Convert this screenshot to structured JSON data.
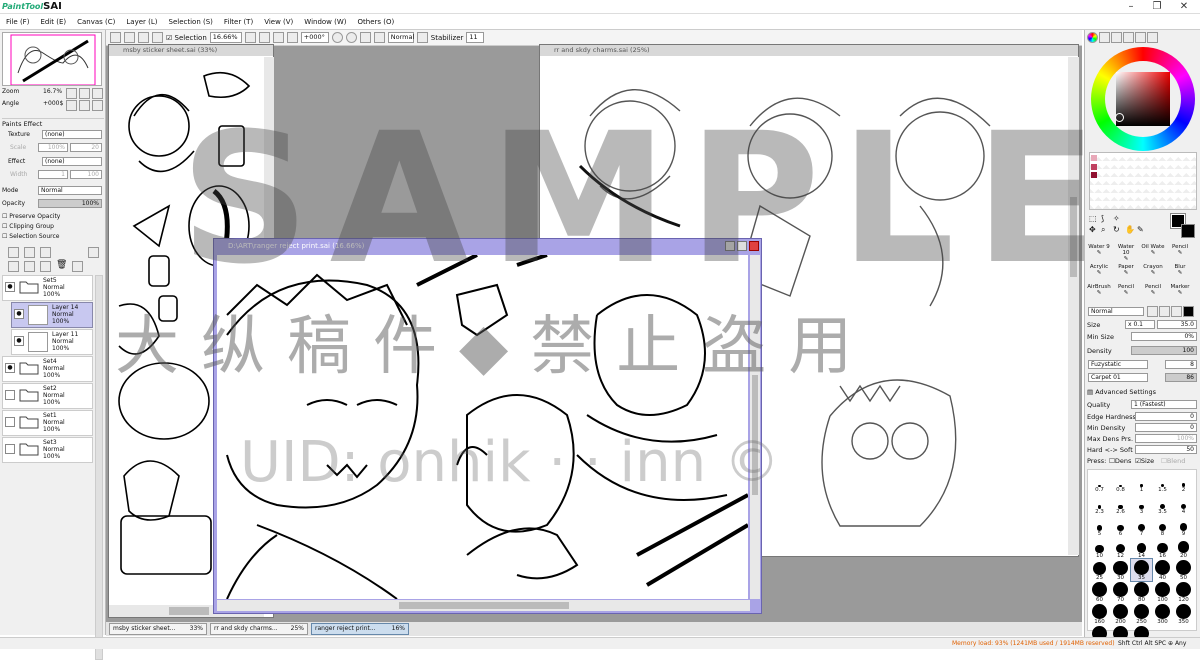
{
  "app": {
    "logo": "PaintTool",
    "logo_b": "SAI",
    "win_min": "–",
    "win_max": "❐",
    "win_close": "✕"
  },
  "menu": [
    "File (F)",
    "Edit (E)",
    "Canvas (C)",
    "Layer (L)",
    "Selection (S)",
    "Filter (T)",
    "View (V)",
    "Window (W)",
    "Others (O)"
  ],
  "toolbar": {
    "selection": "Selection",
    "zoom": "16.66%",
    "angle": "+000°",
    "mode": "Normal",
    "stabilizer_label": "Stabilizer",
    "stabilizer": "11"
  },
  "navigator": {
    "zoom_label": "Zoom",
    "zoom_value": "16.7%",
    "angle_label": "Angle",
    "angle_value": "+000$"
  },
  "paints_effect": {
    "title": "Paints Effect",
    "texture_label": "Texture",
    "texture_value": "(none)",
    "scale_label": "Scale",
    "scale_value": "100%",
    "scale_num": "20",
    "effect_label": "Effect",
    "effect_value": "(none)",
    "width_label": "Width",
    "width_value": "1",
    "width_num": "100"
  },
  "layer_props": {
    "mode_label": "Mode",
    "mode_value": "Normal",
    "opacity_label": "Opacity",
    "opacity_value": "100%",
    "preserve": "Preserve Opacity",
    "clipping": "Clipping Group",
    "selsrc": "Selection Source"
  },
  "layers": [
    {
      "name": "Set5",
      "mode": "Normal",
      "opacity": "100%",
      "type": "folder",
      "visible": true,
      "selected": false,
      "indent": 0
    },
    {
      "name": "Layer 14",
      "mode": "Normal",
      "opacity": "100%",
      "type": "layer",
      "visible": true,
      "selected": true,
      "indent": 1
    },
    {
      "name": "Layer 11",
      "mode": "Normal",
      "opacity": "100%",
      "type": "layer",
      "visible": true,
      "selected": false,
      "indent": 1
    },
    {
      "name": "Set4",
      "mode": "Normal",
      "opacity": "100%",
      "type": "folder",
      "visible": true,
      "selected": false,
      "indent": 0
    },
    {
      "name": "Set2",
      "mode": "Normal",
      "opacity": "100%",
      "type": "folder",
      "visible": false,
      "selected": false,
      "indent": 0
    },
    {
      "name": "Set1",
      "mode": "Normal",
      "opacity": "100%",
      "type": "folder",
      "visible": false,
      "selected": false,
      "indent": 0
    },
    {
      "name": "Set3",
      "mode": "Normal",
      "opacity": "100%",
      "type": "folder",
      "visible": false,
      "selected": false,
      "indent": 0
    }
  ],
  "windows": {
    "w1": "msby sticker sheet.sai (33%)",
    "w2": "rr and skdy charms.sai (25%)",
    "w3": "D:\\ART\\ranger reject print.sai (16.66%)"
  },
  "tasks": [
    {
      "name": "msby sticker sheet...",
      "zoom": "33%"
    },
    {
      "name": "rr and skdy charms...",
      "zoom": "25%"
    },
    {
      "name": "ranger reject print...",
      "zoom": "16%"
    }
  ],
  "tools": [
    "Water 9",
    "Water 10",
    "Oil Wate",
    "Pencil",
    "Acrylic",
    "Paper",
    "Crayon",
    "Blur",
    "AirBrush",
    "Pencil",
    "Pencil",
    "Marker"
  ],
  "brush": {
    "mode": "Normal",
    "size_label": "Size",
    "size_mult": "x 0.1",
    "size_value": "35.0",
    "minsize_label": "Min Size",
    "minsize_value": "0%",
    "density_label": "Density",
    "density_value": "100",
    "tex1": "Fuzystatic",
    "tex1_v": "8",
    "tex2": "Carpet 01",
    "tex2_v": "86",
    "adv": "Advanced Settings",
    "quality_label": "Quality",
    "quality_value": "1 (Fastest)",
    "edge_label": "Edge Hardness",
    "edge_value": "0",
    "mindens_label": "Min Density",
    "mindens_value": "0",
    "maxdens_label": "Max Dens Prs.",
    "maxdens_value": "100%",
    "hard_label": "Hard <-> Soft",
    "hard_value": "50",
    "press_label": "Press:",
    "dens": "Dens",
    "size": "Size",
    "blend": "Blend"
  },
  "brush_sizes": [
    "0.7",
    "0.8",
    "1",
    "1.5",
    "2",
    "2.3",
    "2.6",
    "3",
    "3.5",
    "4",
    "5",
    "6",
    "7",
    "8",
    "9",
    "10",
    "12",
    "14",
    "16",
    "20",
    "25",
    "30",
    "35",
    "40",
    "50",
    "60",
    "70",
    "80",
    "100",
    "120",
    "160",
    "200",
    "250",
    "300",
    "350",
    "400",
    "450",
    "500"
  ],
  "status": {
    "memory": "Memory load: 93% (1241MB used / 1914MB reserved)",
    "keys": "Shft Ctrl Alt SPC ⊕ Any"
  },
  "watermark": {
    "big": "SAMPLE",
    "cn": "大纵稿件◆禁止盗用",
    "uid": "UID: onhik · · inn ©"
  },
  "colors": {
    "accent": "#a9a3e6",
    "selected_layer": "#c8c8f0",
    "memory": "#e06000"
  }
}
